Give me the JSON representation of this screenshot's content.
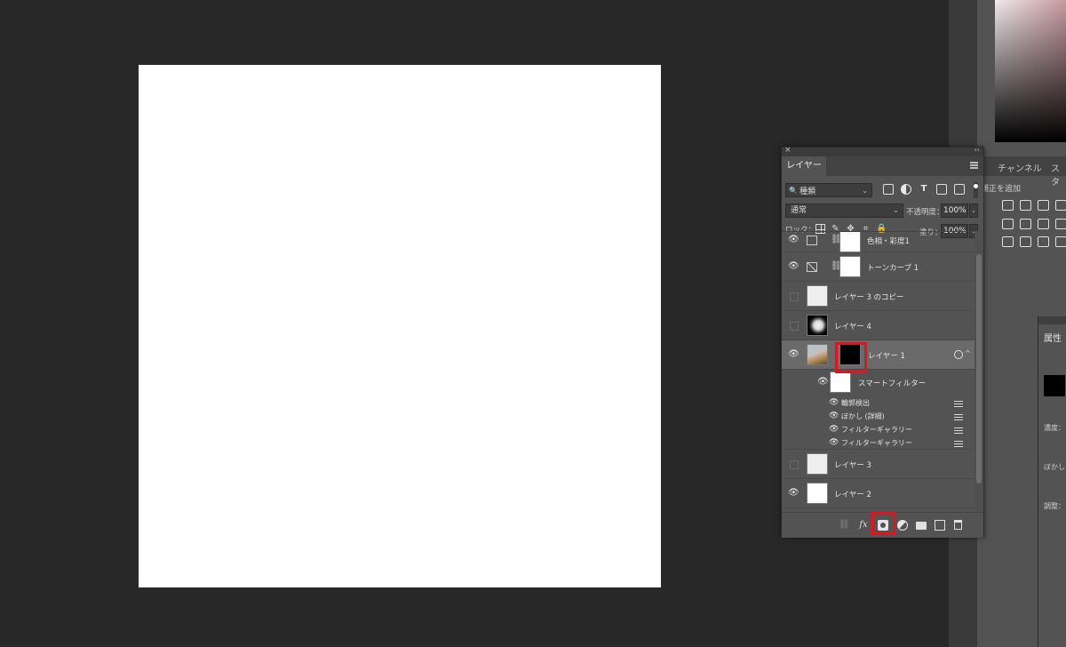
{
  "layers_panel": {
    "tab_label": "レイヤー",
    "kind_filter": "種類",
    "blend_mode": "通常",
    "opacity_label": "不透明度：",
    "opacity_value": "100%",
    "lock_label": "ロック：",
    "fill_label": "塗り：",
    "fill_value": "100%",
    "layers": [
      {
        "name": "色相・彩度1",
        "visible": true,
        "type": "adjustment"
      },
      {
        "name": "トーンカーブ 1",
        "visible": true,
        "type": "adjustment"
      },
      {
        "name": "レイヤー 3 のコピー",
        "visible": false,
        "type": "texture"
      },
      {
        "name": "レイヤー 4",
        "visible": false,
        "type": "dark"
      },
      {
        "name": "レイヤー 1",
        "visible": true,
        "type": "smart-object",
        "selected": true
      },
      {
        "name": "レイヤー 3",
        "visible": false,
        "type": "texture"
      },
      {
        "name": "レイヤー 2",
        "visible": true,
        "type": "white"
      }
    ],
    "smart_filters": {
      "label": "スマートフィルター",
      "items": [
        "輪郭検出",
        "ぼかし (詳細)",
        "フィルターギャラリー",
        "フィルターギャラリー"
      ]
    },
    "footer_icons": [
      "link-icon",
      "fx-icon",
      "add-mask-icon",
      "adjustment-layer-icon",
      "folder-icon",
      "new-layer-icon",
      "trash-icon"
    ],
    "highlight_color": "#e0141e"
  },
  "right_dock": {
    "tabs": [
      "チャンネル",
      "スタ"
    ],
    "adjustments_title": "補正を追加"
  },
  "properties": {
    "title": "属性",
    "labels": [
      "濃度：",
      "ぼかし",
      "調整："
    ]
  },
  "glyphs": {
    "eye": "👁",
    "chain": "⛓",
    "search": "🔍",
    "caret": "⌄",
    "close": "×",
    "collapse": "‹‹",
    "text_T": "T",
    "brush": "✎",
    "move": "✥",
    "crop": "⌗",
    "lock": "🔒",
    "expand": "^"
  }
}
